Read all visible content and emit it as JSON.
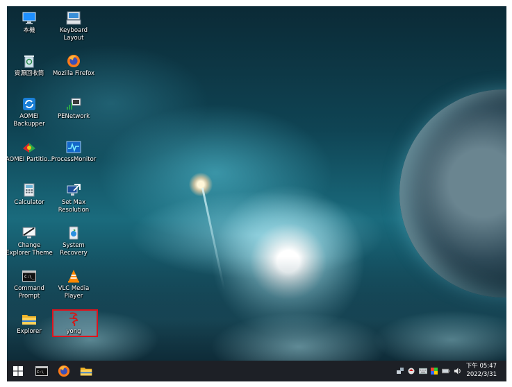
{
  "desktop": {
    "icons": [
      {
        "label": "本機",
        "glyph": "monitor-icon"
      },
      {
        "label": "Keyboard Layout",
        "glyph": "keyboard-icon"
      },
      {
        "label": "資源回收筒",
        "glyph": "recycle-bin-icon"
      },
      {
        "label": "Mozilla Firefox",
        "glyph": "firefox-icon"
      },
      {
        "label": "AOMEI Backupper",
        "glyph": "backupper-icon"
      },
      {
        "label": "PENetwork",
        "glyph": "network-icon"
      },
      {
        "label": "AOMEI Partitio...",
        "glyph": "partition-icon"
      },
      {
        "label": "ProcessMonitor",
        "glyph": "process-monitor-icon"
      },
      {
        "label": "Calculator",
        "glyph": "calculator-icon"
      },
      {
        "label": "Set Max Resolution",
        "glyph": "resolution-icon"
      },
      {
        "label": "Change Explorer Theme",
        "glyph": "theme-icon"
      },
      {
        "label": "System Recovery",
        "glyph": "recovery-icon"
      },
      {
        "label": "Command Prompt",
        "glyph": "cmd-icon"
      },
      {
        "label": "VLC Media Player",
        "glyph": "vlc-icon"
      },
      {
        "label": "Explorer",
        "glyph": "folder-icon"
      },
      {
        "label": "yong",
        "glyph": "yong-icon"
      }
    ]
  },
  "taskbar": {
    "start": "windows-icon",
    "pinned": [
      "cmd-icon",
      "firefox-icon",
      "folder-icon"
    ],
    "tray": [
      "network-tray-icon",
      "security-tray-icon",
      "keyboard-tray-icon",
      "color-tray-icon",
      "battery-tray-icon",
      "volume-tray-icon"
    ],
    "clock_time": "下午 05:47",
    "clock_date": "2022/3/31"
  },
  "colors": {
    "taskbar": "#1d2026",
    "selection_border": "#e0121b"
  }
}
